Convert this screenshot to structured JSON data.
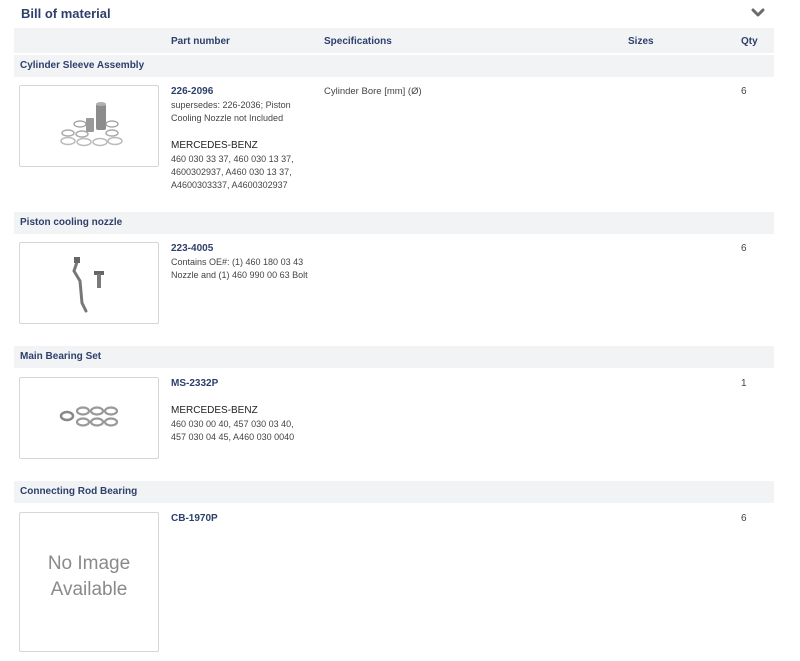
{
  "panel": {
    "title": "Bill of material",
    "collapse_icon": "chevron-down-icon"
  },
  "columns": {
    "part_number": "Part number",
    "specifications": "Specifications",
    "sizes": "Sizes",
    "qty": "Qty"
  },
  "groups": [
    {
      "name": "Cylinder Sleeve Assembly",
      "part_number": "226-2096",
      "note": "supersedes: 226-2036; Piston Cooling Nozzle not Included",
      "manufacturer": "MERCEDES-BENZ",
      "cross_refs": "460 030 33 37, 460 030 13 37, 4600302937, A460 030 13 37, A4600303337, A4600302937",
      "specification": "Cylinder Bore [mm] (Ø)",
      "qty": "6",
      "image": "cylinder-sleeve-kit"
    },
    {
      "name": "Piston cooling nozzle",
      "part_number": "223-4005",
      "note": "Contains OE#: (1) 460 180 03 43 Nozzle and (1) 460 990 00 63 Bolt",
      "qty": "6",
      "image": "cooling-nozzle"
    },
    {
      "name": "Main Bearing Set",
      "part_number": "MS-2332P",
      "manufacturer": "MERCEDES-BENZ",
      "cross_refs": "460 030 00 40, 457 030 03 40, 457 030 04 45, A460 030 0040",
      "qty": "1",
      "image": "bearing-shells"
    },
    {
      "name": "Connecting Rod Bearing",
      "part_number": "CB-1970P",
      "qty": "6",
      "image_placeholder": "No Image Available"
    }
  ]
}
